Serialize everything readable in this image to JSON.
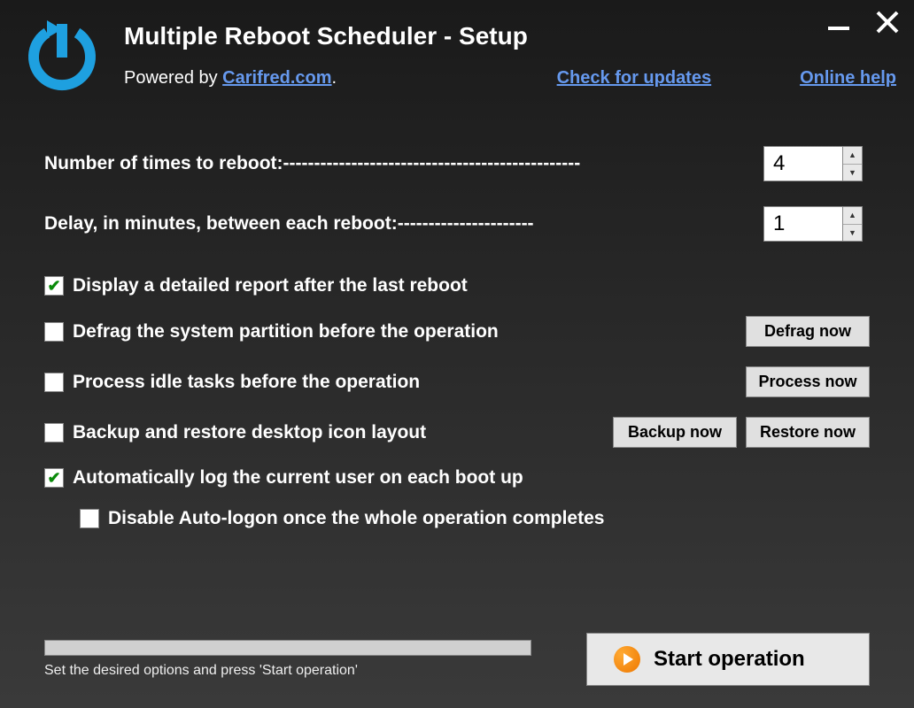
{
  "titlebar": {
    "title": "Multiple Reboot Scheduler - Setup",
    "powered_prefix": "Powered by ",
    "powered_link": "Carifred.com",
    "powered_suffix": ".",
    "check_updates": "Check for updates",
    "online_help": "Online help"
  },
  "settings": {
    "reboot_count_label": "Number of times to reboot:",
    "reboot_count_value": "4",
    "delay_label": "Delay, in minutes, between each reboot:",
    "delay_value": "1"
  },
  "options": {
    "display_report": {
      "label": "Display a detailed report after the last reboot",
      "checked": true
    },
    "defrag": {
      "label": "Defrag the system partition before the operation",
      "checked": false,
      "btn": "Defrag now"
    },
    "process_idle": {
      "label": "Process idle tasks before the operation",
      "checked": false,
      "btn": "Process now"
    },
    "backup_restore": {
      "label": "Backup and restore desktop icon layout",
      "checked": false,
      "btn1": "Backup now",
      "btn2": "Restore now"
    },
    "auto_logon": {
      "label": "Automatically log the current user on each boot up",
      "checked": true
    },
    "disable_auto": {
      "label": "Disable Auto-logon once the whole operation completes",
      "checked": false
    }
  },
  "footer": {
    "hint": "Set the desired options and press 'Start operation'",
    "start": "Start operation"
  }
}
